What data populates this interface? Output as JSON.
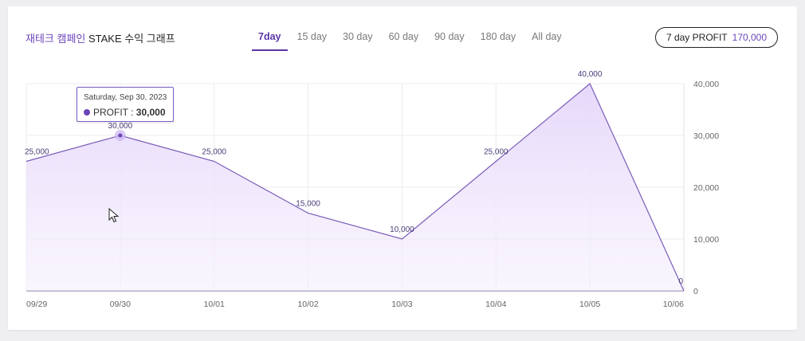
{
  "header": {
    "title_accent": "재테크 캠페인",
    "title_rest": " STAKE 수익 그래프",
    "tabs": [
      {
        "label": "7day",
        "active": true
      },
      {
        "label": "15 day",
        "active": false
      },
      {
        "label": "30 day",
        "active": false
      },
      {
        "label": "60 day",
        "active": false
      },
      {
        "label": "90 day",
        "active": false
      },
      {
        "label": "180 day",
        "active": false
      },
      {
        "label": "All day",
        "active": false
      }
    ],
    "profit_label": "7 day PROFIT",
    "profit_value": "170,000"
  },
  "tooltip": {
    "date": "Saturday, Sep 30, 2023",
    "series": "PROFIT",
    "separator": " : ",
    "value": "30,000"
  },
  "colors": {
    "accent": "#6b45b8",
    "line": "#7a5cb8",
    "area_top": "#e6d9fb",
    "grid": "#ececf0"
  },
  "chart_data": {
    "type": "area",
    "x": [
      "09/29",
      "09/30",
      "10/01",
      "10/02",
      "10/03",
      "10/04",
      "10/05",
      "10/06"
    ],
    "series": [
      {
        "values": [
          25000,
          30000,
          25000,
          15000,
          10000,
          25000,
          40000,
          0
        ]
      }
    ],
    "data_labels": [
      "25,000",
      "30,000",
      "25,000",
      "15,000",
      "10,000",
      "25,000",
      "40,000",
      "0"
    ],
    "y_ticks": [
      "0",
      "10,000",
      "20,000",
      "30,000",
      "40,000"
    ],
    "ylim": [
      0,
      40000
    ],
    "grid": true,
    "y_axis_side": "right",
    "highlighted_index": 1
  }
}
